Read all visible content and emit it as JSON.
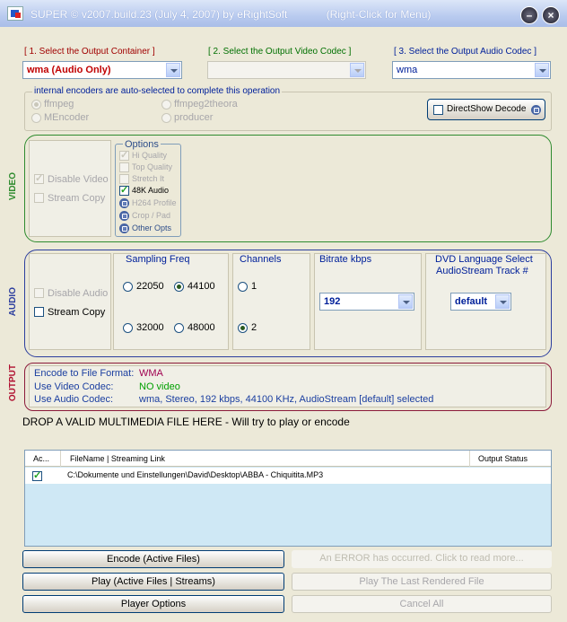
{
  "window": {
    "title": "SUPER © v2007.build.23 (July 4, 2007) by eRightSoft",
    "hint": "(Right-Click for Menu)",
    "minimize_label": "–",
    "close_label": "×"
  },
  "steps": {
    "container_label": "[ 1.    Select the Output Container ]",
    "video_codec_label": "[ 2.   Select the Output Video Codec ]",
    "audio_codec_label": "[ 3.   Select the Output Audio Codec ]",
    "container_value": "wma  (Audio Only)",
    "video_codec_value": "",
    "audio_codec_value": "wma"
  },
  "encoders": {
    "title": "internal encoders are auto-selected to complete this operation",
    "options": [
      "ffmpeg",
      "MEncoder",
      "ffmpeg2theora",
      "producer"
    ],
    "directshow_label": "DirectShow Decode"
  },
  "video": {
    "side_label": "VIDEO",
    "disable_label": "Disable Video",
    "stream_copy_label": "Stream Copy",
    "options_title": "Options",
    "options": [
      "Hi Quality",
      "Top Quality",
      "Stretch It",
      "48K Audio",
      "H264 Profile",
      "Crop / Pad",
      "Other Opts"
    ]
  },
  "audio": {
    "side_label": "AUDIO",
    "disable_label": "Disable Audio",
    "stream_copy_label": "Stream Copy",
    "sampling_title": "Sampling Freq",
    "sampling": [
      "22050",
      "44100",
      "32000",
      "48000"
    ],
    "channels_title": "Channels",
    "channels": [
      "1",
      "2"
    ],
    "bitrate_title": "Bitrate  kbps",
    "bitrate_value": "192",
    "dvd_title_1": "DVD Language Select",
    "dvd_title_2": "AudioStream  Track #",
    "dvd_value": "default"
  },
  "output": {
    "side_label": "OUTPUT",
    "rows": [
      {
        "label": "Encode to File Format:",
        "value": "WMA"
      },
      {
        "label": "Use Video Codec:",
        "value": "NO video"
      },
      {
        "label": "Use Audio Codec:",
        "value": "wma,  Stereo,  192 kbps,  44100 KHz,  AudioStream [default] selected"
      }
    ]
  },
  "drop_text": "DROP A VALID MULTIMEDIA FILE HERE - Will try to play or encode",
  "file_list": {
    "headers": [
      "Ac...",
      "FileName  |  Streaming Link",
      "Output Status"
    ],
    "rows": [
      {
        "file": "C:\\Dokumente und Einstellungen\\David\\Desktop\\ABBA - Chiquitita.MP3",
        "status": ""
      }
    ]
  },
  "buttons": {
    "encode": "Encode (Active Files)",
    "error": "An ERROR has occurred.  Click to read more...",
    "play": "Play (Active Files | Streams)",
    "play_last": "Play The Last Rendered File",
    "player_options": "Player Options",
    "cancel_all": "Cancel All"
  },
  "colors": {
    "container_text": "#C00000",
    "video_panel": "#2E8B2E",
    "audio_panel": "#2C3E9E",
    "output_panel": "#8B1A3A",
    "output_label": "#1A3EA0",
    "output_value": "#A00050",
    "list_bg": "#CFE8F5"
  }
}
